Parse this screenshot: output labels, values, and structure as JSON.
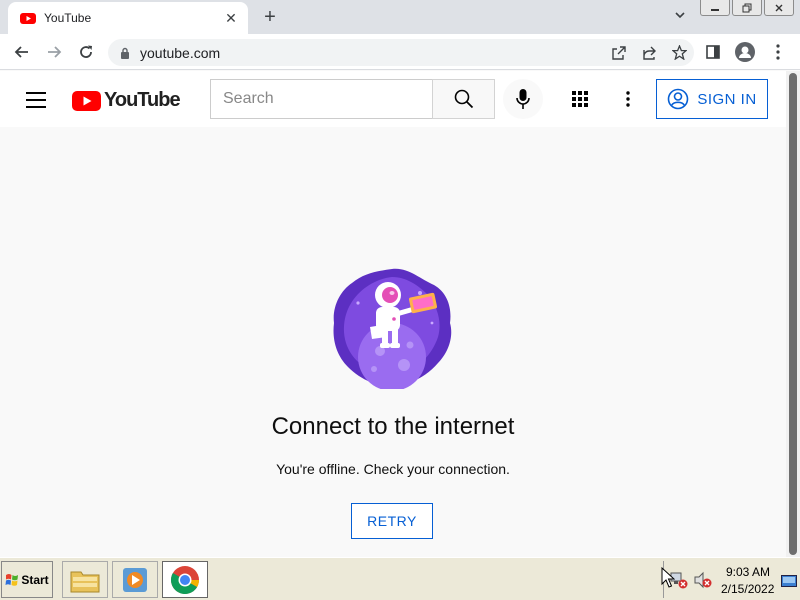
{
  "browser": {
    "tab_title": "YouTube",
    "url": "youtube.com",
    "new_tab_icon": "plus-icon",
    "tab_list_icon": "chevron-down-icon"
  },
  "youtube": {
    "logo_text": "YouTube",
    "search_placeholder": "Search",
    "signin_label": "SIGN IN",
    "brand_red": "#ff0000",
    "link_blue": "#065fd4"
  },
  "offline": {
    "title": "Connect to the internet",
    "subtitle": "You're offline. Check your connection.",
    "retry_label": "RETRY"
  },
  "taskbar": {
    "start_label": "Start",
    "apps": [
      "file-explorer-icon",
      "media-player-icon",
      "chrome-icon"
    ],
    "time": "9:03 AM",
    "date": "2/15/2022"
  }
}
